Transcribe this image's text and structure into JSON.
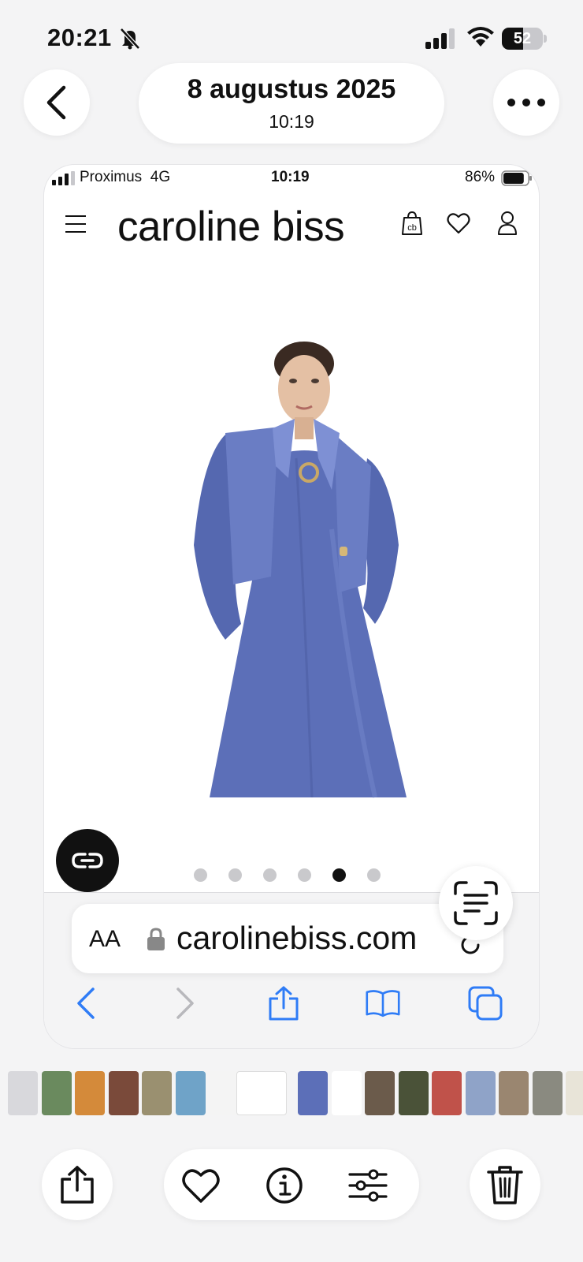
{
  "os_status": {
    "time": "20:21",
    "battery": "52",
    "battery_fraction": 0.52
  },
  "photos_header": {
    "date": "8 augustus 2025",
    "time": "10:19"
  },
  "screenshot": {
    "status": {
      "carrier": "Proximus",
      "network": "4G",
      "time": "10:19",
      "battery": "86%",
      "battery_fraction": 0.86
    },
    "site": {
      "logo": "caroline biss",
      "bag_icon_text": "cb"
    },
    "carousel": {
      "count": 6,
      "active_index": 4
    },
    "browser": {
      "text_size_label": "AA",
      "url": "carolinebiss.com"
    }
  },
  "thumbnails": [
    {
      "color": "#d8d8dc"
    },
    {
      "color": "#6a8a5e"
    },
    {
      "color": "#d48a3a"
    },
    {
      "color": "#7a4a3a"
    },
    {
      "color": "#9a9070"
    },
    {
      "color": "#6fa3c8"
    },
    {
      "color": "#f4f4f4"
    },
    {
      "color": "#ffffff"
    },
    {
      "color": "#5c6fb8"
    },
    {
      "color": "#ffffff"
    },
    {
      "color": "#6b5b4b"
    },
    {
      "color": "#4a5238"
    },
    {
      "color": "#c0524a"
    },
    {
      "color": "#8fa3c8"
    },
    {
      "color": "#9a8670"
    },
    {
      "color": "#8a8a80"
    },
    {
      "color": "#e8e4d8"
    }
  ],
  "colors": {
    "ios_blue": "#2f7cf6",
    "dress_blue": "#5c6fb8",
    "background": "#f4f4f5"
  },
  "icons": {
    "header": [
      "chevron-left-icon",
      "ellipsis-icon"
    ],
    "site": [
      "hamburger-menu-icon",
      "shopping-bag-icon",
      "heart-icon",
      "user-icon"
    ],
    "browser": [
      "lock-icon",
      "reload-icon",
      "back-arrow-icon",
      "forward-arrow-icon",
      "share-icon",
      "bookmarks-icon",
      "tabs-icon"
    ],
    "toolbar": [
      "share-icon",
      "heart-icon",
      "info-icon",
      "adjust-sliders-icon",
      "trash-icon"
    ]
  }
}
